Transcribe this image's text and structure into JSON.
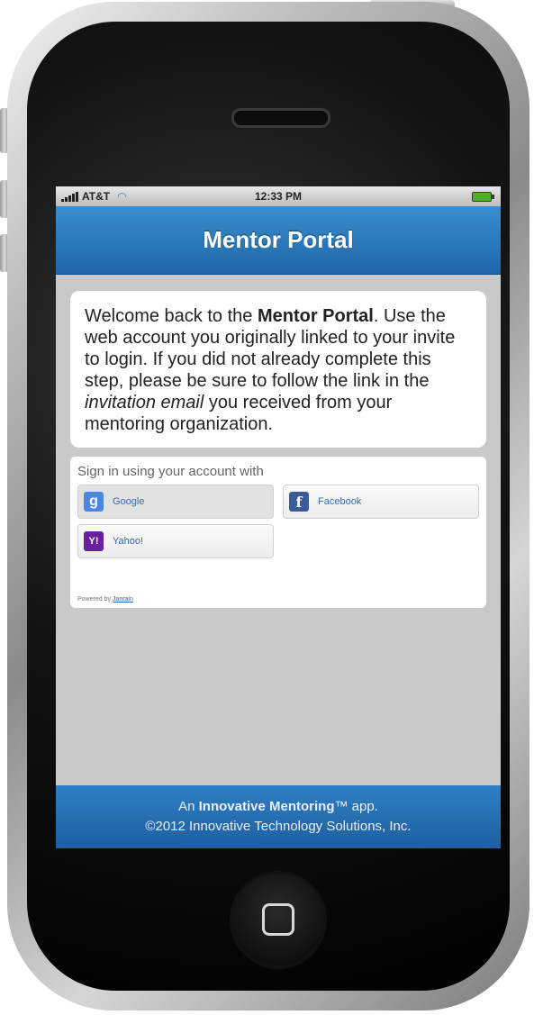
{
  "status_bar": {
    "carrier": "AT&T",
    "time": "12:33 PM"
  },
  "header": {
    "title": "Mentor Portal"
  },
  "welcome": {
    "part1": "Welcome back to the ",
    "bold": "Mentor Portal",
    "part2": ". Use the web account you originally linked to your invite to login. If you did not already complete this step, please be sure to follow the link in the ",
    "italic": "invitation email",
    "part3": " you received from your mentoring organization."
  },
  "signin": {
    "label": "Sign in using your account with",
    "providers": [
      {
        "label": "Google",
        "icon": "google-icon"
      },
      {
        "label": "Facebook",
        "icon": "facebook-icon"
      },
      {
        "label": "Yahoo!",
        "icon": "yahoo-icon"
      }
    ],
    "powered_prefix": "Powered by ",
    "powered_link": "Janrain"
  },
  "footer": {
    "line1_prefix": "An ",
    "line1_bold": "Innovative Mentoring",
    "line1_suffix": "™ app.",
    "line2": "©2012 Innovative Technology Solutions, Inc."
  },
  "colors": {
    "header_blue": "#2a7bc2",
    "screen_bg": "#c9c9c9"
  }
}
